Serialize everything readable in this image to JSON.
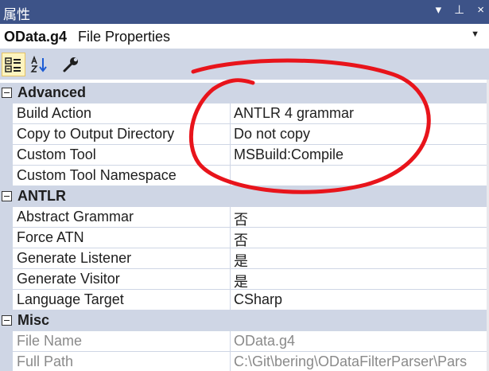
{
  "window": {
    "title": "属性",
    "dropdown_icon": "▾",
    "pin_icon": "⊥",
    "close_icon": "×"
  },
  "selector": {
    "object_name": "OData.g4",
    "object_type": "File Properties"
  },
  "toolbar": {
    "categorized": "categorized-icon",
    "alphabetical": "alphabetical-icon",
    "property_pages": "wrench-icon"
  },
  "grid": {
    "categories": [
      {
        "label": "Advanced",
        "properties": [
          {
            "name": "Build Action",
            "value": "ANTLR 4 grammar"
          },
          {
            "name": "Copy to Output Directory",
            "value": "Do not copy"
          },
          {
            "name": "Custom Tool",
            "value": "MSBuild:Compile"
          },
          {
            "name": "Custom Tool Namespace",
            "value": ""
          }
        ]
      },
      {
        "label": "ANTLR",
        "properties": [
          {
            "name": "Abstract Grammar",
            "value": "否"
          },
          {
            "name": "Force ATN",
            "value": "否"
          },
          {
            "name": "Generate Listener",
            "value": "是"
          },
          {
            "name": "Generate Visitor",
            "value": "是"
          },
          {
            "name": "Language Target",
            "value": "CSharp"
          }
        ]
      },
      {
        "label": "Misc",
        "properties": [
          {
            "name": "File Name",
            "value": "OData.g4"
          },
          {
            "name": "Full Path",
            "value": "C:\\Git\\bering\\ODataFilterParser\\Pars"
          }
        ]
      }
    ]
  },
  "colors": {
    "titlebar": "#3d5388",
    "category_bg": "#cfd6e5",
    "annotation": "#e8141b"
  }
}
